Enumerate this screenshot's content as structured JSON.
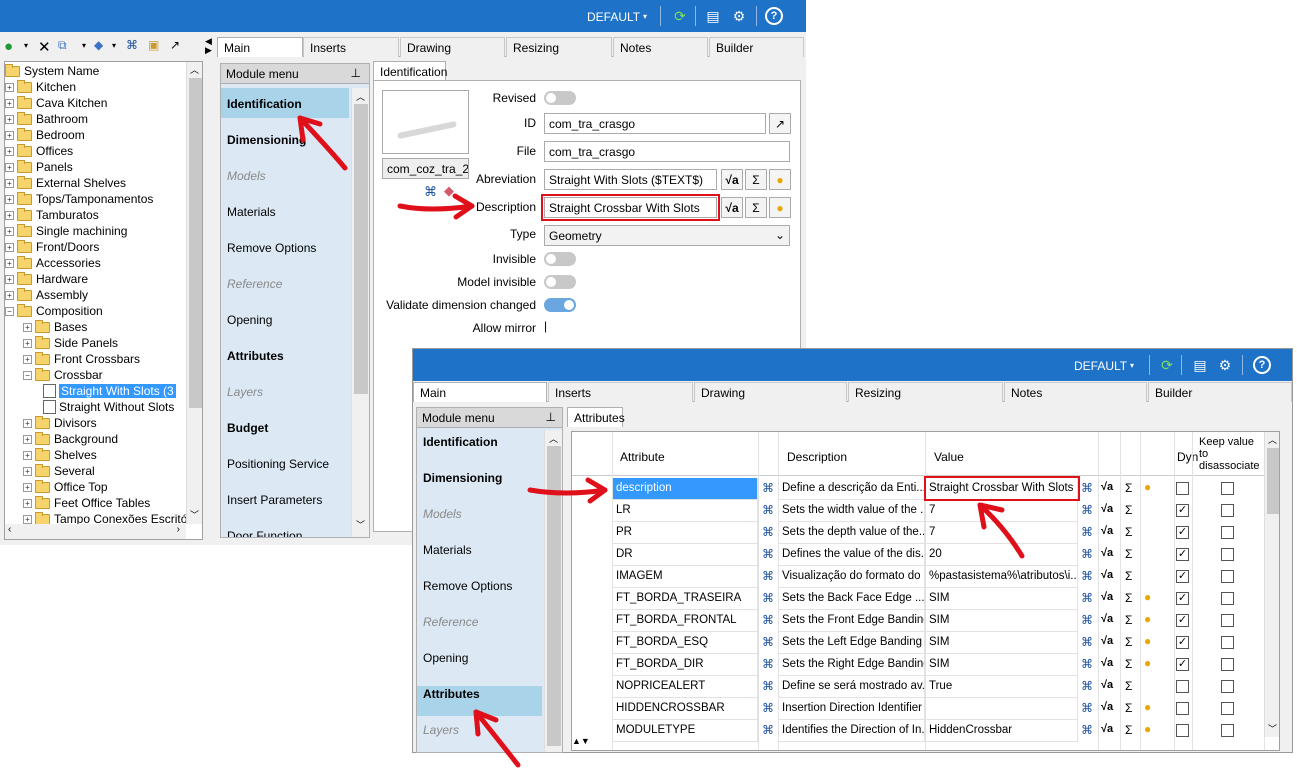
{
  "window1": {
    "profile": "DEFAULT",
    "tabs": [
      "Main",
      "Inserts",
      "Drawing",
      "Resizing",
      "Notes",
      "Builder"
    ],
    "tree": {
      "root": "System Name",
      "items": [
        "Kitchen",
        "Cava Kitchen",
        "Bathroom",
        "Bedroom",
        "Offices",
        "Panels",
        "External Shelves",
        "Tops/Tamponamentos",
        "Tamburatos",
        "Single machining",
        "Front/Doors",
        "Accessories",
        "Hardware",
        "Assembly",
        "Composition"
      ],
      "composition_children": [
        "Bases",
        "Side Panels",
        "Front Crossbars",
        "Crossbar"
      ],
      "crossbar_children": [
        "Straight With Slots  (3",
        "Straight Without Slots"
      ],
      "after": [
        "Divisors",
        "Background",
        "Shelves",
        "Several",
        "Office Top",
        "Feet Office Tables",
        "Tampo Conexões Escritór"
      ]
    },
    "menu": {
      "header": "Module menu",
      "items": [
        "Identification",
        "Dimensioning",
        "Models",
        "Materials",
        "Remove Options",
        "Reference",
        "Opening",
        "Attributes",
        "Layers",
        "Budget",
        "Positioning Service",
        "Insert Parameters",
        "Door Function"
      ]
    },
    "identification": {
      "tab": "Identification",
      "thumb_name": "com_coz_tra_2",
      "labels": {
        "revised": "Revised",
        "id": "ID",
        "file": "File",
        "abbrev": "Abreviation",
        "description": "Description",
        "type": "Type",
        "invisible": "Invisible",
        "model_invisible": "Model invisible",
        "validate": "Validate dimension changed",
        "allow_mirror": "Allow mirror"
      },
      "values": {
        "id": "com_tra_crasgo",
        "file": "com_tra_crasgo",
        "abbrev": "Straight With Slots  ($TEXT$)",
        "description": "Straight Crossbar With Slots",
        "type": "Geometry"
      }
    }
  },
  "window2": {
    "profile": "DEFAULT",
    "tabs": [
      "Main",
      "Inserts",
      "Drawing",
      "Resizing",
      "Notes",
      "Builder"
    ],
    "menu": {
      "header": "Module menu",
      "items": [
        "Identification",
        "Dimensioning",
        "Models",
        "Materials",
        "Remove Options",
        "Reference",
        "Opening",
        "Attributes",
        "Layers"
      ]
    },
    "attributes_tab": "Attributes",
    "columns": {
      "attribute": "Attribute",
      "description": "Description",
      "value": "Value",
      "dyn": "Dyn",
      "keep": "Keep value to disassociate"
    },
    "rows": [
      {
        "attr": "description",
        "desc": "Define a descrição da Enti...",
        "value": "Straight Crossbar With Slots",
        "bubble": true,
        "dyn": false,
        "keep": false
      },
      {
        "attr": "LR",
        "desc": "Sets the width value of the ...",
        "value": "7",
        "bubble": false,
        "dyn": true,
        "keep": false
      },
      {
        "attr": "PR",
        "desc": "Sets the depth value of the...",
        "value": "7",
        "bubble": false,
        "dyn": true,
        "keep": false
      },
      {
        "attr": "DR",
        "desc": "Defines the value of the dis...",
        "value": "20",
        "bubble": false,
        "dyn": true,
        "keep": false
      },
      {
        "attr": "IMAGEM",
        "desc": "Visualização do formato do ...",
        "value": "%pastasistema%\\atributos\\i...",
        "bubble": false,
        "dyn": true,
        "keep": false
      },
      {
        "attr": "FT_BORDA_TRASEIRA",
        "desc": "Sets the Back Face Edge ...",
        "value": "SIM",
        "bubble": true,
        "dyn": true,
        "keep": false
      },
      {
        "attr": "FT_BORDA_FRONTAL",
        "desc": "Sets the Front Edge Banding",
        "value": "SIM",
        "bubble": true,
        "dyn": true,
        "keep": false
      },
      {
        "attr": "FT_BORDA_ESQ",
        "desc": "Sets the Left Edge Banding",
        "value": "SIM",
        "bubble": true,
        "dyn": true,
        "keep": false
      },
      {
        "attr": "FT_BORDA_DIR",
        "desc": "Sets the Right Edge Banding",
        "value": "SIM",
        "bubble": true,
        "dyn": true,
        "keep": false
      },
      {
        "attr": "NOPRICEALERT",
        "desc": "Define se será mostrado av...",
        "value": "True",
        "bubble": false,
        "dyn": false,
        "keep": false
      },
      {
        "attr": "HIDDENCROSSBAR",
        "desc": "Insertion Direction Identifier",
        "value": "",
        "bubble": true,
        "dyn": false,
        "keep": false
      },
      {
        "attr": "MODULETYPE",
        "desc": "Identifies the Direction of In...",
        "value": "HiddenCrossbar",
        "bubble": true,
        "dyn": false,
        "keep": false
      }
    ]
  }
}
